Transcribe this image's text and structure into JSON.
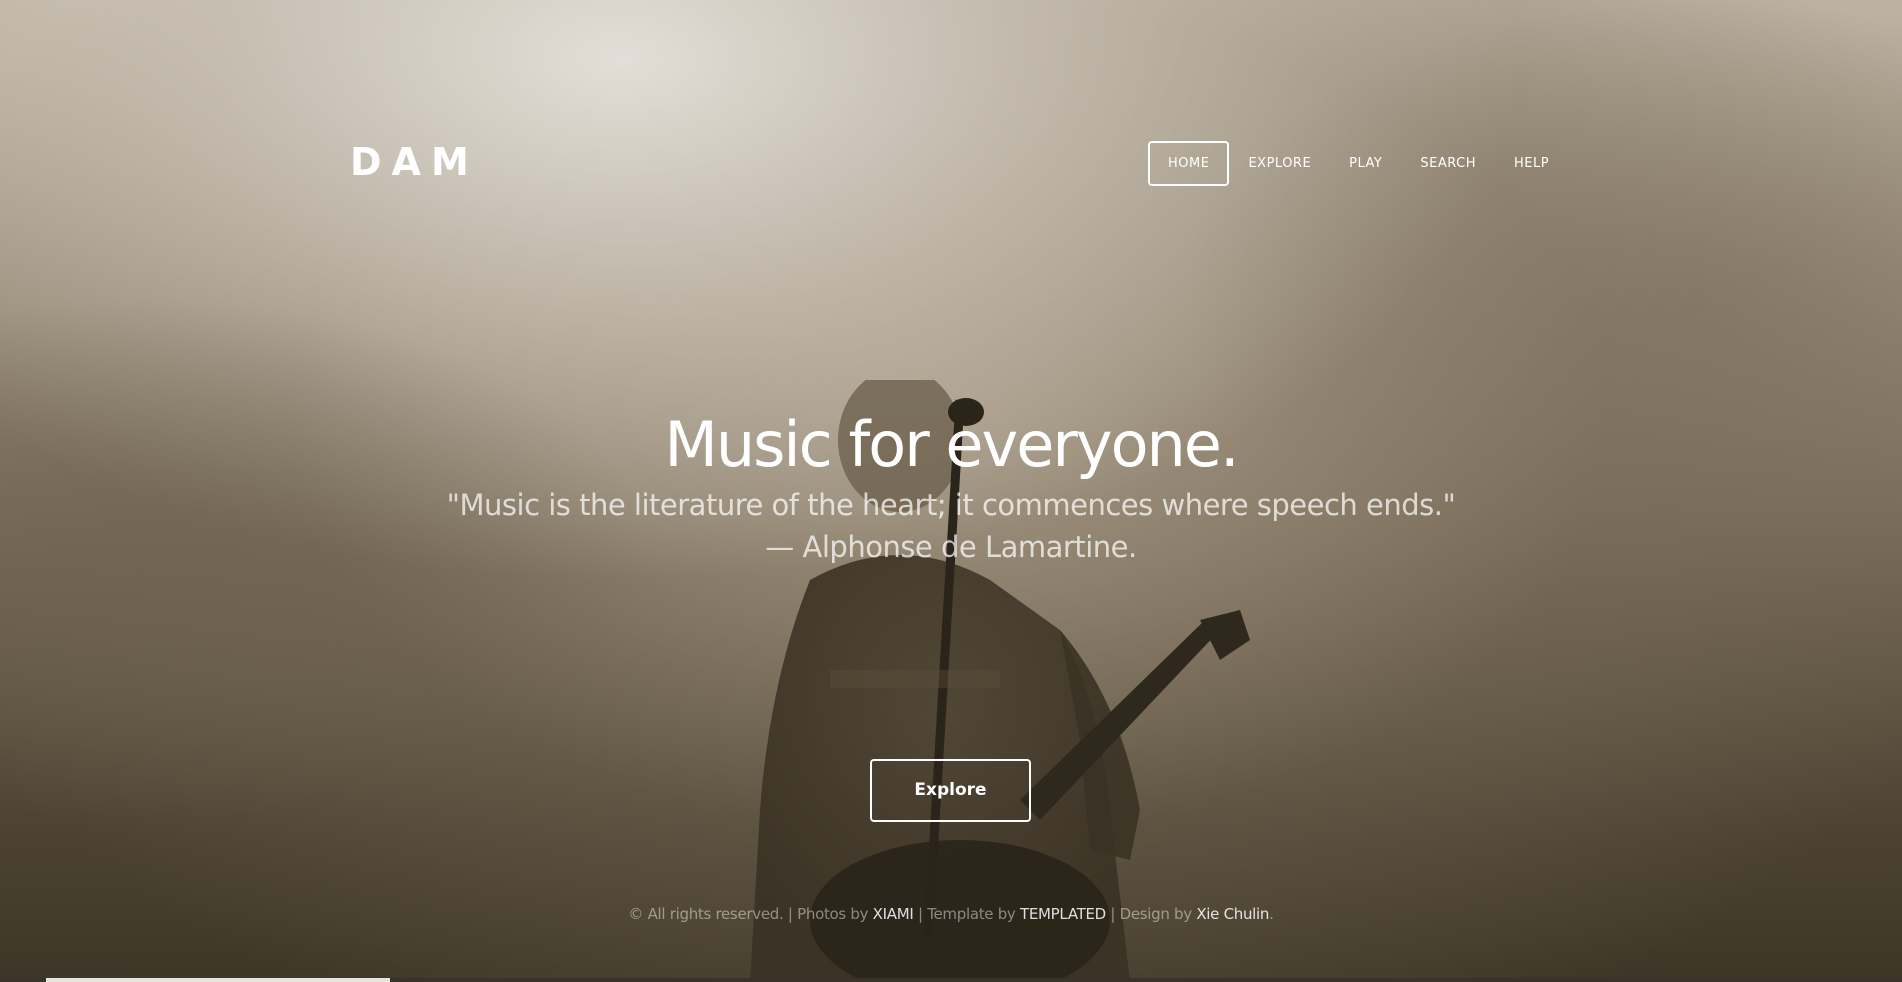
{
  "header": {
    "logo": "DAM",
    "nav": [
      {
        "label": "HOME",
        "active": true
      },
      {
        "label": "EXPLORE",
        "active": false
      },
      {
        "label": "PLAY",
        "active": false
      },
      {
        "label": "SEARCH",
        "active": false
      },
      {
        "label": "HELP",
        "active": false
      }
    ]
  },
  "hero": {
    "title": "Music for everyone.",
    "quote_line1": "\"Music is the literature of the heart; it commences where speech ends.\"",
    "quote_line2": "— Alphonse de Lamartine.",
    "button_label": "Explore"
  },
  "footer": {
    "copyright": "© All rights reserved. | Photos by ",
    "photos_link": "XIAMI",
    "template_text": " | Template by ",
    "template_link": "TEMPLATED",
    "design_text": " | Design by ",
    "design_link": "Xie Chulin",
    "end": "."
  },
  "colors": {
    "text": "#ffffff",
    "background_dark": "#3d3627",
    "background_light": "#e2ddd5"
  }
}
